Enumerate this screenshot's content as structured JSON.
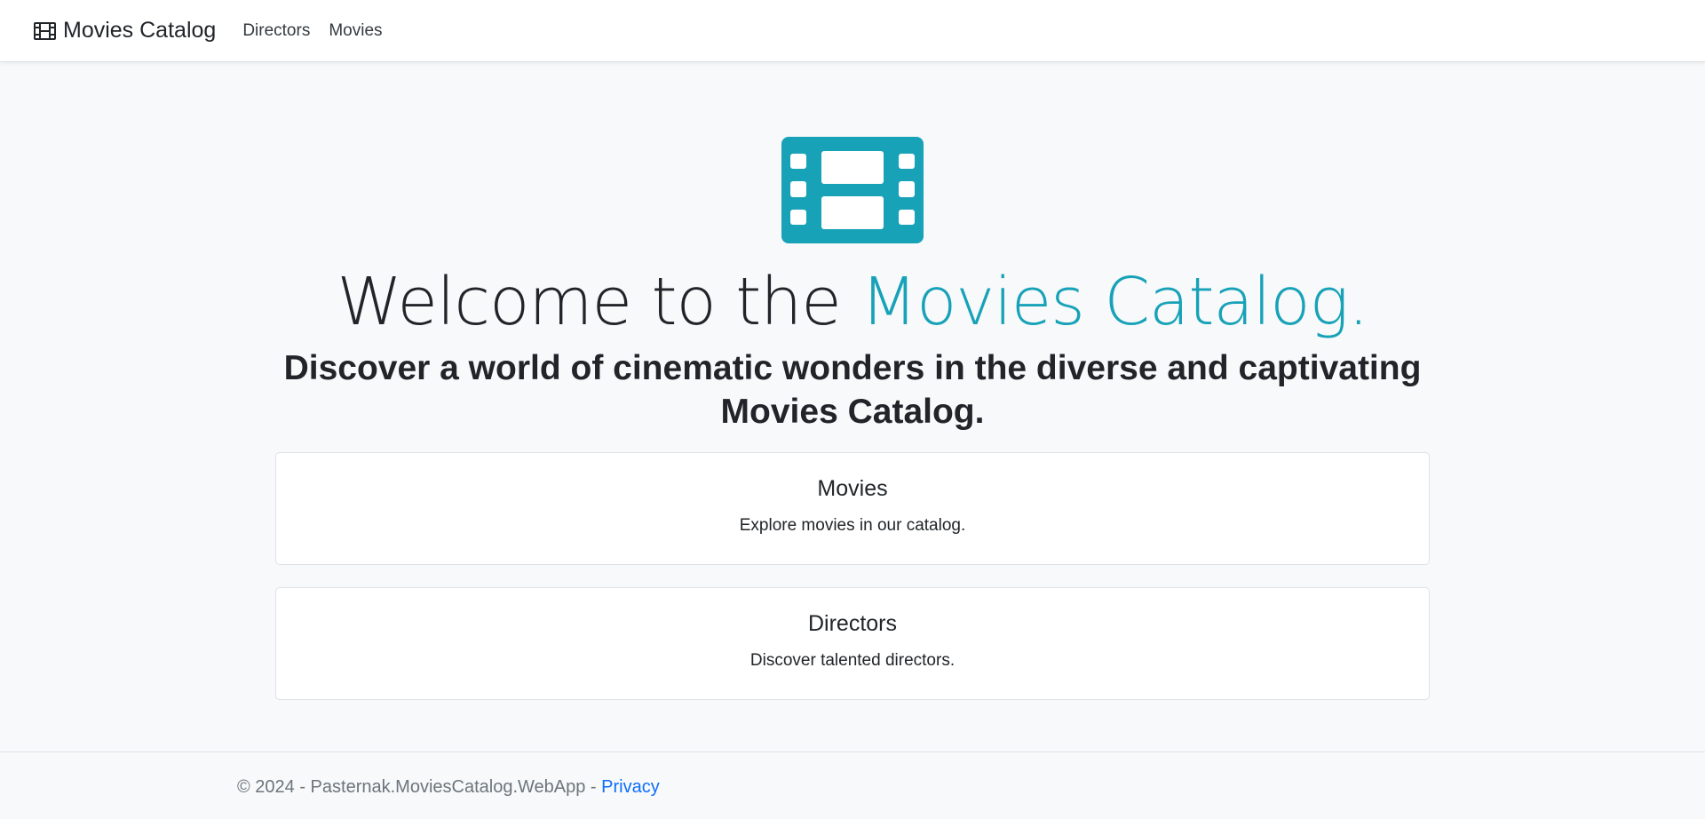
{
  "navbar": {
    "brand_label": "Movies Catalog",
    "brand_icon": "film-icon",
    "links": [
      {
        "label": "Directors"
      },
      {
        "label": "Movies"
      }
    ]
  },
  "hero": {
    "icon": "film-icon",
    "welcome_prefix": "Welcome to the ",
    "welcome_accent": "Movies Catalog.",
    "subtitle": "Discover a world of cinematic wonders in the diverse and captivating Movies Catalog."
  },
  "cards": [
    {
      "title": "Movies",
      "text": "Explore movies in our catalog."
    },
    {
      "title": "Directors",
      "text": "Discover talented directors."
    }
  ],
  "footer": {
    "text": "© 2024 - Pasternak.MoviesCatalog.WebApp - ",
    "privacy_label": "Privacy"
  },
  "colors": {
    "accent": "#17a2b8",
    "link": "#0d6efd",
    "text": "#212529",
    "muted": "#6c757d",
    "background": "#f8f9fa"
  }
}
